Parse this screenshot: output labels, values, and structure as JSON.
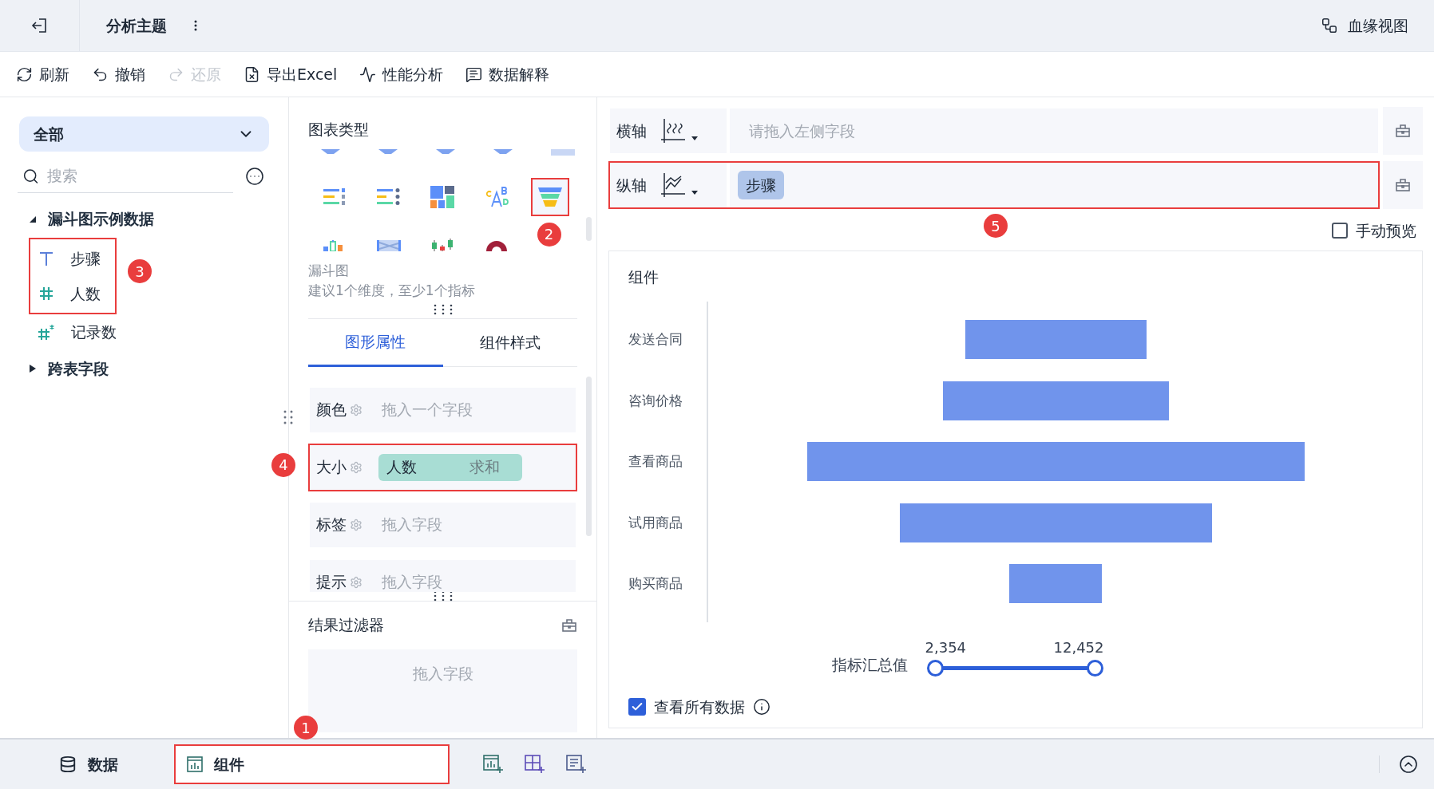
{
  "header": {
    "title": "分析主题",
    "lineage_label": "血缘视图"
  },
  "toolbar": [
    {
      "label": "刷新",
      "disabled": false
    },
    {
      "label": "撤销",
      "disabled": false
    },
    {
      "label": "还原",
      "disabled": true
    },
    {
      "label": "导出Excel",
      "disabled": false
    },
    {
      "label": "性能分析",
      "disabled": false
    },
    {
      "label": "数据解释",
      "disabled": false
    }
  ],
  "data_panel": {
    "scope": "全部",
    "search_placeholder": "搜索",
    "tree": [
      {
        "label": "漏斗图示例数据",
        "expanded": true,
        "children": [
          {
            "label": "步骤",
            "kind": "text",
            "highlighted": true
          },
          {
            "label": "人数",
            "kind": "number",
            "highlighted": true
          },
          {
            "label": "记录数",
            "kind": "count",
            "highlighted": false
          }
        ]
      },
      {
        "label": "跨表字段",
        "expanded": false
      }
    ],
    "callout": "3"
  },
  "chart_types": {
    "title": "图表类型",
    "items": [
      {
        "kind": "rank-list",
        "selected": false
      },
      {
        "kind": "dot-list",
        "selected": false
      },
      {
        "kind": "treemap",
        "selected": false
      },
      {
        "kind": "word-cloud",
        "selected": false
      },
      {
        "kind": "funnel",
        "selected": true,
        "callout": "2"
      },
      {
        "kind": "bar-mix",
        "selected": false
      },
      {
        "kind": "flow",
        "selected": false
      },
      {
        "kind": "candlestick",
        "selected": false
      },
      {
        "kind": "gauge",
        "selected": false
      }
    ],
    "name": "漏斗图",
    "hint": "建议1个维度，至少1个指标"
  },
  "property_tabs": [
    {
      "label": "图形属性",
      "selected": true
    },
    {
      "label": "组件样式",
      "selected": false
    }
  ],
  "properties": [
    {
      "label": "颜色",
      "hint": "拖入一个字段",
      "highlighted": false
    },
    {
      "label": "大小",
      "field": "人数",
      "aggregation": "求和",
      "highlighted": true,
      "callout": "4"
    },
    {
      "label": "标签",
      "hint": "拖入字段",
      "highlighted": false
    },
    {
      "label": "提示",
      "hint": "拖入字段",
      "highlighted": false
    }
  ],
  "result_filter": {
    "title": "结果过滤器",
    "hint": "拖入字段"
  },
  "axes": [
    {
      "label": "横轴",
      "hint": "请拖入左侧字段",
      "highlighted": false
    },
    {
      "label": "纵轴",
      "fields": [
        "步骤"
      ],
      "highlighted": true,
      "callout": "5"
    }
  ],
  "manual_preview": {
    "label": "手动预览",
    "checked": false
  },
  "component": {
    "title": "组件",
    "categories": [
      "发送合同",
      "咨询价格",
      "查看商品",
      "试用商品",
      "购买商品"
    ],
    "size_legend": {
      "label": "指标汇总值",
      "min": "2,354",
      "max": "12,452",
      "level": 1
    },
    "show_all_data": {
      "label": "查看所有数据",
      "checked": true
    }
  },
  "bottom_tabs": [
    {
      "label": "数据",
      "selected": false,
      "highlighted": false
    },
    {
      "label": "组件",
      "selected": true,
      "highlighted": true,
      "callout": "1"
    }
  ]
}
